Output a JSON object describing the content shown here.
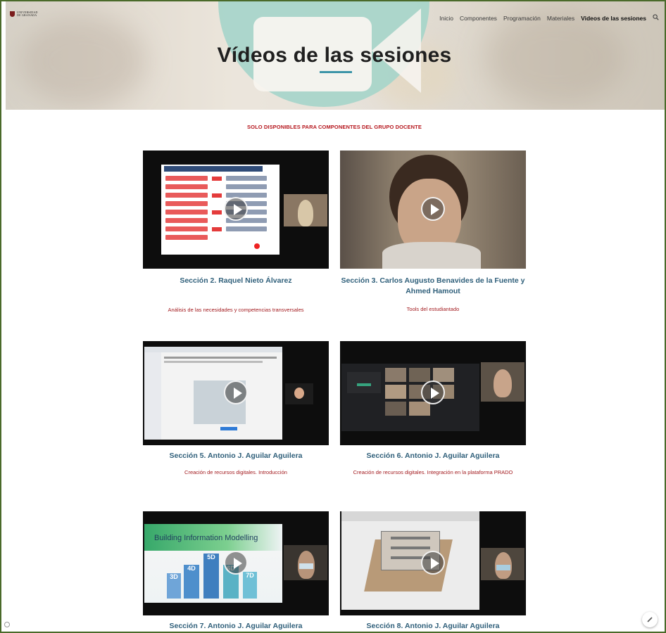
{
  "site": {
    "logo_text": "UNIVERSIDAD DE GRANADA"
  },
  "nav": {
    "items": [
      "Inicio",
      "Componentes",
      "Programación",
      "Materiales",
      "Videos de las sesiones"
    ],
    "active_index": 4,
    "search_icon": "search-icon"
  },
  "header": {
    "title": "Vídeos de las sesiones"
  },
  "notice": "SOLO DISPONIBLES PARA COMPONENTES DEL GRUPO DOCENTE",
  "videos": [
    {
      "title": "Sección 2. Raquel Nieto Álvarez",
      "description": "Análisis de las necesidades y competencias transversales"
    },
    {
      "title": "Sección 3. Carlos Augusto Benavides de la Fuente y Ahmed Hamout",
      "description": "Tools del estudiantado"
    },
    {
      "title": "Sección 5. Antonio J. Aguilar Aguilera",
      "description": "Creación de recursos digitales. Introducción"
    },
    {
      "title": "Sección 6. Antonio J. Aguilar Aguilera",
      "description": "Creación de recursos digitales. Integración en la plataforma PRADO"
    },
    {
      "title": "Sección 7. Antonio J. Aguilar Aguilera",
      "description": ""
    },
    {
      "title": "Sección 8. Antonio J. Aguilar Aguilera",
      "description": ""
    }
  ],
  "thumb_text": {
    "bim_slide_title": "Building Information Modelling",
    "bim_labels": [
      "3D",
      "4D",
      "5D",
      "6D",
      "7D"
    ]
  },
  "colors": {
    "accent": "#3d95a8",
    "title_blue": "#2f5f7a",
    "notice_red": "#b5161d"
  }
}
